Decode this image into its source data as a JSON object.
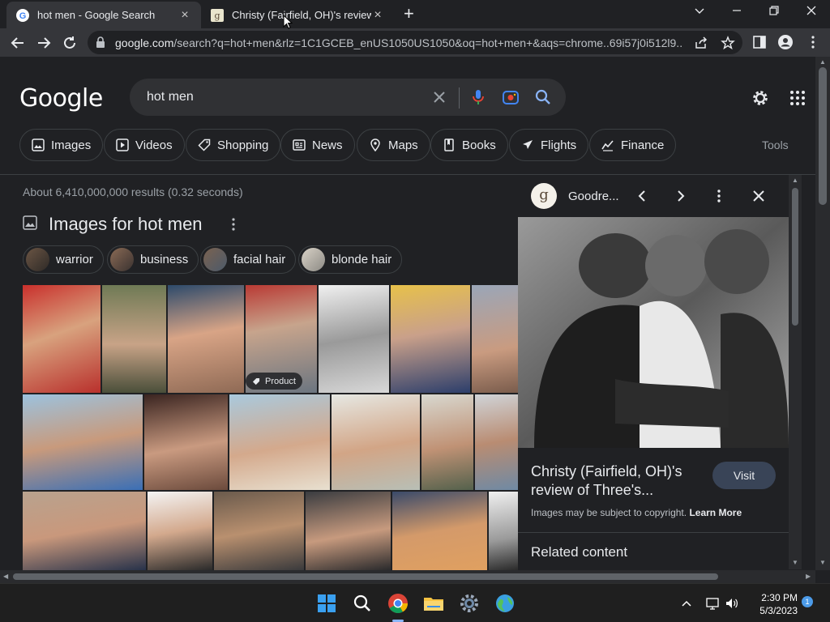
{
  "browser": {
    "tabs": [
      {
        "title": "hot men - Google Search",
        "active": true
      },
      {
        "title": "Christy (Fairfield, OH)'s review of",
        "active": false
      }
    ],
    "url_host": "google.com",
    "url_rest": "/search?q=hot+men&rlz=1C1GCEB_enUS1050US1050&oq=hot+men+&aqs=chrome..69i57j0i512l9...."
  },
  "google": {
    "logo": "Google",
    "query": "hot men",
    "chips": [
      {
        "label": "Images",
        "icon": "image-icon"
      },
      {
        "label": "Videos",
        "icon": "play-icon"
      },
      {
        "label": "Shopping",
        "icon": "tag-icon"
      },
      {
        "label": "News",
        "icon": "news-icon"
      },
      {
        "label": "Maps",
        "icon": "map-pin-icon"
      },
      {
        "label": "Books",
        "icon": "book-icon"
      },
      {
        "label": "Flights",
        "icon": "airplane-icon"
      },
      {
        "label": "Finance",
        "icon": "finance-icon"
      }
    ],
    "tools": "Tools",
    "results_stats": "About 6,410,000,000 results (0.32 seconds)",
    "images_heading": "Images for hot men",
    "refinements": [
      "warrior",
      "business",
      "facial hair",
      "blonde hair"
    ],
    "product_badge": "Product"
  },
  "panel": {
    "source": "Goodre...",
    "source_logo": "g",
    "title": "Christy (Fairfield, OH)'s review of Three's...",
    "visit": "Visit",
    "copyright": "Images may be subject to copyright.",
    "learn_more": "Learn More",
    "related": "Related content"
  },
  "taskbar": {
    "time": "2:30 PM",
    "date": "5/3/2023",
    "notifications": "1"
  },
  "colors": {
    "background": "#202124",
    "surface": "#303134",
    "accent_blue": "#8ab4f8",
    "visit_button": "#394457"
  }
}
